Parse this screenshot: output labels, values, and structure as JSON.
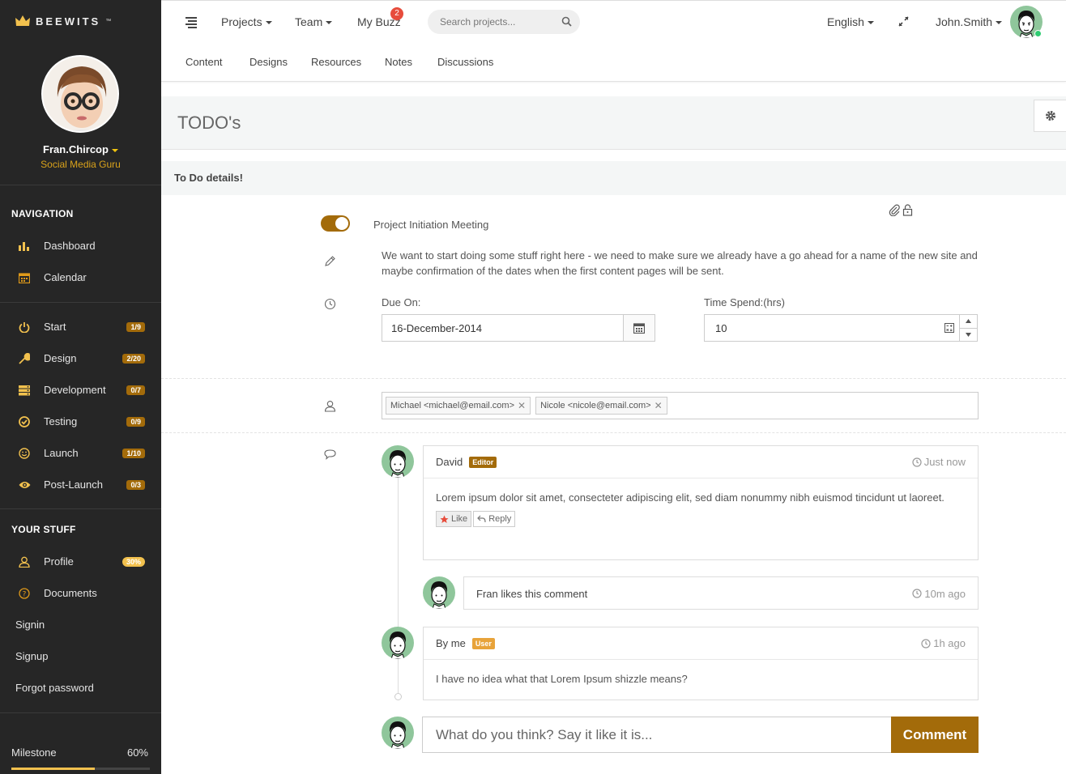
{
  "brand": {
    "name": "BEEWITS",
    "tm": "™"
  },
  "profile": {
    "name": "Fran.Chircop",
    "role": "Social Media Guru"
  },
  "nav": {
    "heading": "NAVIGATION",
    "items": [
      {
        "label": "Dashboard",
        "icon": "bar-chart-icon"
      },
      {
        "label": "Calendar",
        "icon": "calendar-icon"
      }
    ],
    "phases": [
      {
        "label": "Start",
        "badge": "1/9",
        "icon": "power-icon"
      },
      {
        "label": "Design",
        "badge": "2/20",
        "icon": "wrench-icon"
      },
      {
        "label": "Development",
        "badge": "0/7",
        "icon": "server-icon"
      },
      {
        "label": "Testing",
        "badge": "0/9",
        "icon": "check-circle-icon"
      },
      {
        "label": "Launch",
        "badge": "1/10",
        "icon": "smile-icon"
      },
      {
        "label": "Post-Launch",
        "badge": "0/3",
        "icon": "eye-icon"
      }
    ]
  },
  "stuff": {
    "heading": "YOUR STUFF",
    "profile_label": "Profile",
    "profile_badge": "30%",
    "documents_label": "Documents",
    "links": [
      "Signin",
      "Signup",
      "Forgot password"
    ]
  },
  "milestone": {
    "label": "Milestone",
    "value": "60%",
    "fraction": 0.6
  },
  "topbar": {
    "projects": "Projects",
    "team": "Team",
    "buzz": "My Buzz",
    "buzz_count": "2",
    "search_placeholder": "Search projects...",
    "language": "English",
    "user": "John.Smith"
  },
  "subnav": [
    "Content",
    "Designs",
    "Resources",
    "Notes",
    "Discussions"
  ],
  "page": {
    "title": "TODO's",
    "panel_title": "To Do details!"
  },
  "todo": {
    "title": "Project Initiation Meeting",
    "enabled": true,
    "description": "We want to start doing some stuff right here - we need to make sure we already have a go ahead for a name of the new site and maybe confirmation of the dates when the first content pages will be sent.",
    "due_label": "Due On:",
    "due_value": "16-December-2014",
    "time_label": "Time Spend:(hrs)",
    "time_value": "10",
    "assignees": [
      "Michael <michael@email.com>",
      "Nicole <nicole@email.com>"
    ]
  },
  "comments": [
    {
      "author": "David",
      "role": "Editor",
      "role_color": "#a36b0a",
      "time": "Just now",
      "text": "Lorem ipsum dolor sit amet, consecteter adipiscing elit, sed diam nonummy nibh euismod tincidunt ut laoreet.",
      "like": "Like",
      "reply": "Reply"
    },
    {
      "text": "Fran likes this comment",
      "time": "10m ago"
    },
    {
      "author": "By me",
      "role": "User",
      "role_color": "#e8a33a",
      "time": "1h ago",
      "text": "I have no idea what that Lorem Ipsum shizzle means?"
    }
  ],
  "composer": {
    "placeholder": "What do you think? Say it like it is...",
    "button": "Comment"
  },
  "colors": {
    "sidebar": "#262626",
    "accent": "#a36b0a",
    "yellow": "#f2c14e",
    "avatar_bg": "#8fc69b"
  }
}
